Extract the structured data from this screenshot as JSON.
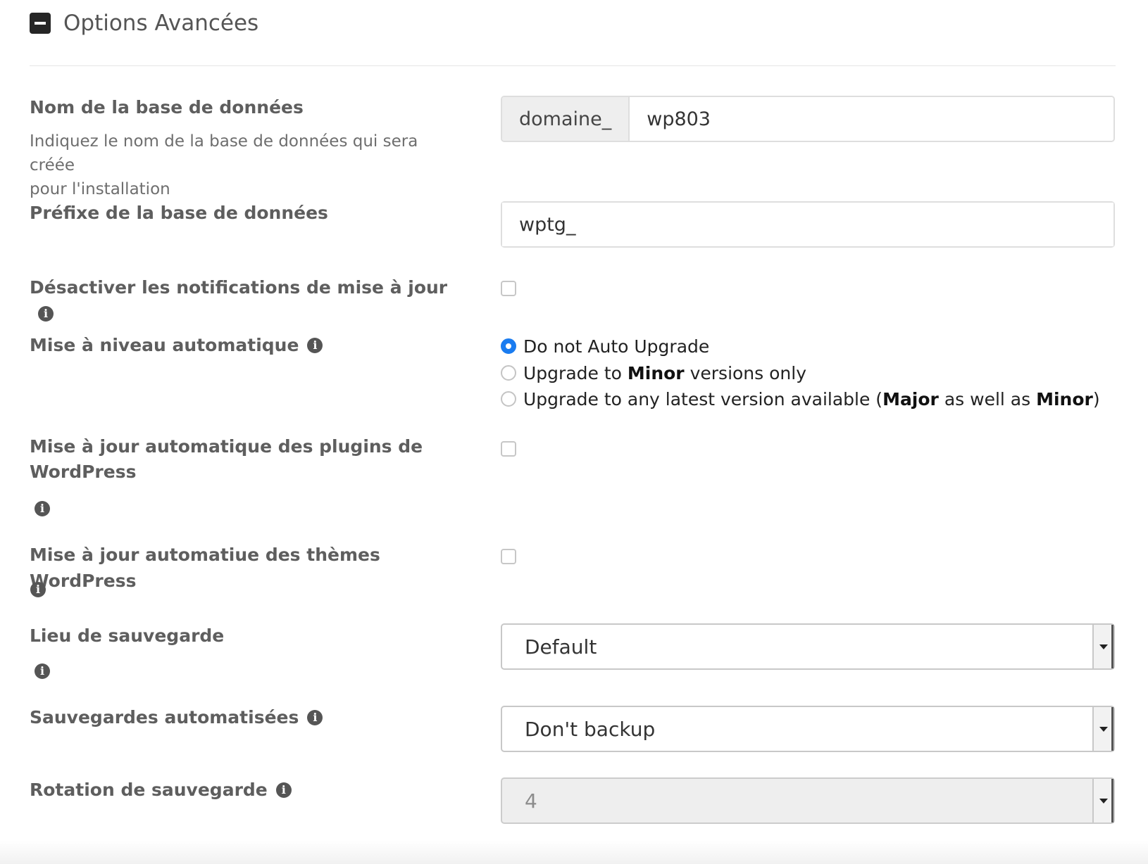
{
  "section": {
    "title": "Options Avancées",
    "icon": "minus-square-icon"
  },
  "db_name": {
    "label": "Nom de la base de données",
    "help_line1": "Indiquez le nom de la base de données qui sera créée",
    "help_line2": "pour l'installation",
    "prefix_addon": "domaine_",
    "value": "wp803"
  },
  "db_prefix": {
    "label": "Préfixe de la base de données",
    "value": "wptg_"
  },
  "disable_notifications": {
    "label": "Désactiver les notifications de mise à jour",
    "checked": false
  },
  "auto_upgrade": {
    "label": "Mise à niveau automatique",
    "options": [
      {
        "text": "Do not Auto Upgrade",
        "checked": true
      },
      {
        "pre": "Upgrade to ",
        "bold": "Minor",
        "post": " versions only",
        "checked": false
      },
      {
        "pre": "Upgrade to any latest version available (",
        "bold1": "Major",
        "mid": " as well as ",
        "bold2": "Minor",
        "post": ")",
        "checked": false
      }
    ]
  },
  "auto_update_plugins": {
    "label_line1": "Mise à jour automatique des plugins de",
    "label_line2": "WordPress",
    "checked": false
  },
  "auto_update_themes": {
    "label": "Mise à jour automatiue des thèmes WordPress",
    "checked": false
  },
  "backup_location": {
    "label": "Lieu de sauvegarde",
    "value": "Default"
  },
  "automated_backups": {
    "label": "Sauvegardes automatisées",
    "value": "Don't backup"
  },
  "backup_rotation": {
    "label": "Rotation de sauvegarde",
    "value": "4",
    "disabled": true
  },
  "info_glyph": "i"
}
